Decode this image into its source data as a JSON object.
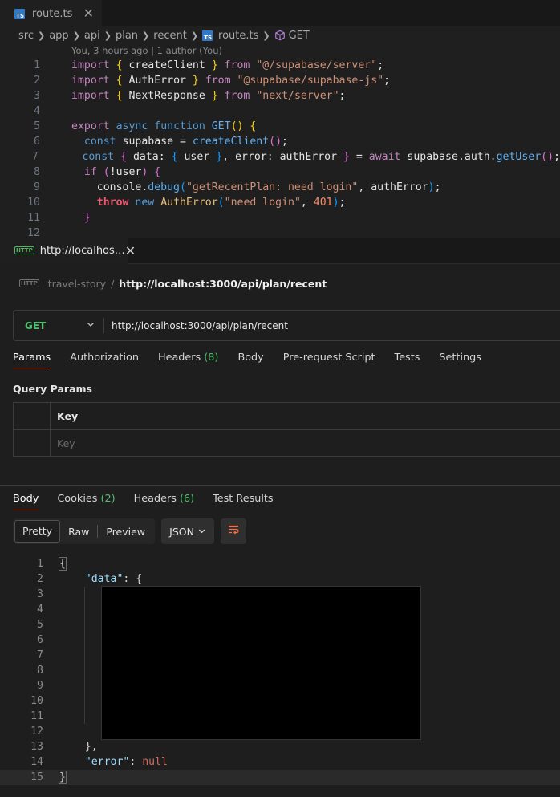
{
  "editor": {
    "tab": {
      "label": "route.ts",
      "icon": "ts-file-icon"
    },
    "breadcrumb": [
      "src",
      "app",
      "api",
      "plan",
      "recent",
      "route.ts",
      "GET"
    ],
    "blame": "You, 3 hours ago | 1 author (You)",
    "line_numbers": [
      "1",
      "2",
      "3",
      "4",
      "5",
      "6",
      "7",
      "8",
      "9",
      "10",
      "11",
      "12"
    ]
  },
  "client": {
    "tab": {
      "label": "http://localhos…",
      "icon": "http-icon"
    },
    "collection": "travel-story",
    "request_name": "http://localhost:3000/api/plan/recent",
    "method": "GET",
    "url": "http://localhost:3000/api/plan/recent",
    "request_tabs": {
      "params": "Params",
      "authorization": "Authorization",
      "headers": "Headers",
      "headers_count": "(8)",
      "body": "Body",
      "prerequest": "Pre-request Script",
      "tests": "Tests",
      "settings": "Settings"
    },
    "query_params": {
      "title": "Query Params",
      "header_key": "Key",
      "placeholder_key": "Key"
    },
    "response_tabs": {
      "body": "Body",
      "cookies": "Cookies",
      "cookies_count": "(2)",
      "headers": "Headers",
      "headers_count": "(6)",
      "test_results": "Test Results"
    },
    "view": {
      "pretty": "Pretty",
      "raw": "Raw",
      "preview": "Preview",
      "format": "JSON"
    },
    "json_line_numbers": [
      "1",
      "2",
      "3",
      "4",
      "5",
      "6",
      "7",
      "8",
      "9",
      "10",
      "11",
      "12",
      "13",
      "14",
      "15"
    ]
  },
  "colors": {
    "accent_tab": "#ff6c37",
    "method_get": "#4fc16f",
    "ts_badge": "#3178c6"
  }
}
